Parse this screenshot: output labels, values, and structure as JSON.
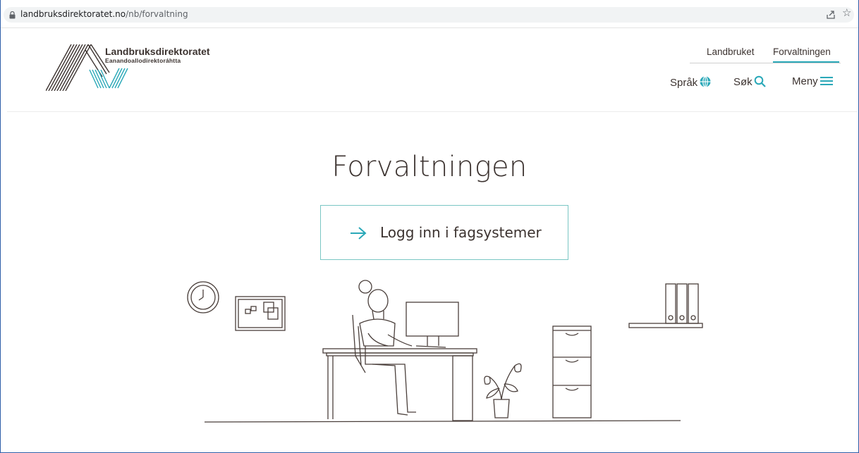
{
  "browser": {
    "url_domain": "landbruksdirektoratet.no",
    "url_path": "/nb/forvaltning",
    "icons": [
      "lock-icon",
      "share-icon",
      "star-icon"
    ]
  },
  "header": {
    "logo_title": "Landbruksdirektoratet",
    "logo_subtitle": "Eanandoallodirektoráhtta",
    "tabs": [
      {
        "label": "Landbruket",
        "active": false
      },
      {
        "label": "Forvaltningen",
        "active": true
      }
    ],
    "utilities": {
      "language": "Språk",
      "search": "Søk",
      "menu": "Meny"
    }
  },
  "main": {
    "title": "Forvaltningen",
    "login_button": "Logg inn i fagsystemer"
  },
  "colors": {
    "accent": "#2aa8b8",
    "text": "#3c3330",
    "button_border": "#7ac6c4"
  }
}
